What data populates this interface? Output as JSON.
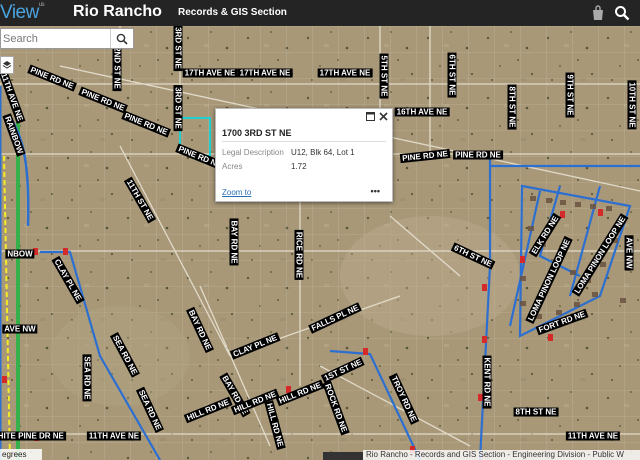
{
  "header": {
    "logo_prefix": "",
    "logo_text": "View",
    "logo_sup": "us",
    "title": "Rio Rancho",
    "subtitle": "Records & GIS Section"
  },
  "search": {
    "placeholder": "Search"
  },
  "popup": {
    "title": "1700 3RD ST NE",
    "rows": [
      {
        "label": "Legal Description",
        "value": "U12, Blk 64, Lot 1"
      },
      {
        "label": "Acres",
        "value": "1.72"
      }
    ],
    "zoom_label": "Zoom to",
    "more_label": "•••"
  },
  "map": {
    "labels": [
      {
        "text": "17TH AVE NE"
      },
      {
        "text": "17TH AVE NE"
      },
      {
        "text": "17TH AVE NE"
      },
      {
        "text": "16TH AVE NE"
      },
      {
        "text": "PINE RD NE"
      },
      {
        "text": "PINE RD NE"
      },
      {
        "text": "PINE RD NE"
      },
      {
        "text": "PINE RD NE"
      },
      {
        "text": "PINE RD NE"
      },
      {
        "text": "PINE RD NE"
      },
      {
        "text": "3RD ST NE"
      },
      {
        "text": "3RD ST NE"
      },
      {
        "text": "2ND ST NE"
      },
      {
        "text": "5TH ST NE"
      },
      {
        "text": "6TH ST NE"
      },
      {
        "text": "8TH ST NE"
      },
      {
        "text": "9TH ST NE"
      },
      {
        "text": "10TH ST NE"
      },
      {
        "text": "11TH ST NE"
      },
      {
        "text": "BAY RD NE"
      },
      {
        "text": "BAY RD NE"
      },
      {
        "text": "BAY RD NE"
      },
      {
        "text": "RICE RD NE"
      },
      {
        "text": "6TH ST NE"
      },
      {
        "text": "FALLS PL NE"
      },
      {
        "text": "CLAY PL NE"
      },
      {
        "text": "CLAY PL NE"
      },
      {
        "text": "SEA RD NE"
      },
      {
        "text": "SEA RD NE"
      },
      {
        "text": "SEA RD NE"
      },
      {
        "text": "1ST ST NE"
      },
      {
        "text": "HILL RD NE"
      },
      {
        "text": "HILL RD NE"
      },
      {
        "text": "HILL RD NE"
      },
      {
        "text": "HILL RD NE"
      },
      {
        "text": "ROCK RD NE"
      },
      {
        "text": "TROY RD NE"
      },
      {
        "text": "KENT RD NE"
      },
      {
        "text": "8TH ST NE"
      },
      {
        "text": "FORT RD NE"
      },
      {
        "text": "ELK RD NE"
      },
      {
        "text": "LOMA PINON LOOP NE"
      },
      {
        "text": "LOMA PINON LOOP NE"
      },
      {
        "text": "WHITE PINE DR NE"
      },
      {
        "text": "11TH AVE NE"
      },
      {
        "text": "11TH AVE NE"
      },
      {
        "text": "11TH AVE NE"
      },
      {
        "text": "RAINBOW"
      },
      {
        "text": "NBOW"
      },
      {
        "text": "AVE NW"
      },
      {
        "text": "AVE NW"
      },
      {
        "text": "11TH ST NE"
      }
    ]
  },
  "attribution": "Rio Rancho - Records and GIS Section - Engineering Division - Public W",
  "scale_text": "egrees",
  "colors": {
    "header_bg": "#242424",
    "accent_blue": "#2c6fd1",
    "parcel_cyan": "#20d0d0",
    "road_yellow": "#f4ec24",
    "road_green": "#36b04a",
    "terrain": "#a89878"
  }
}
